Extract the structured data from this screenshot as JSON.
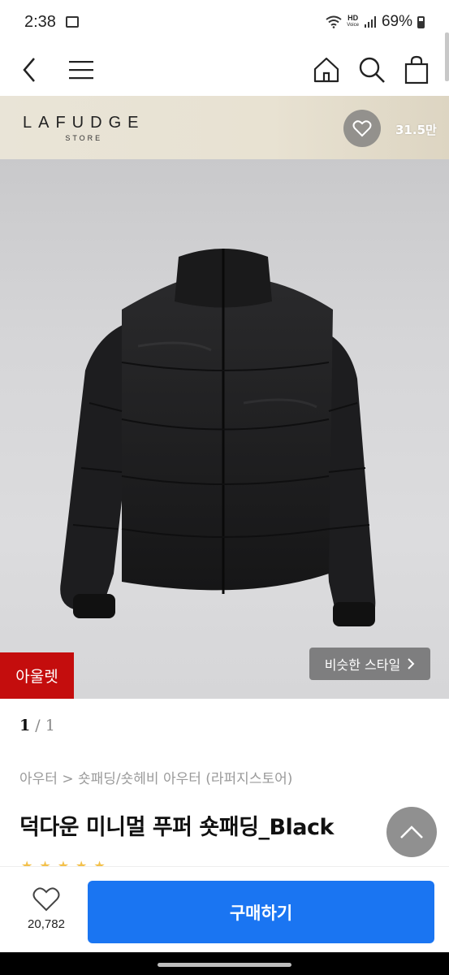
{
  "status_bar": {
    "time": "2:38",
    "network_label": "HD",
    "network_sub": "Voice",
    "battery": "69%"
  },
  "nav": {
    "back_icon": "back-arrow-icon",
    "menu_icon": "hamburger-menu-icon",
    "home_icon": "home-icon",
    "search_icon": "search-icon",
    "cart_icon": "shopping-bag-icon"
  },
  "store": {
    "name": "LAFUDGE",
    "sub": "STORE",
    "favorites": "31.5만"
  },
  "image": {
    "outlet_badge": "아울렛",
    "similar_style": "비슷한 스타일"
  },
  "gallery": {
    "current": "1",
    "total": "1"
  },
  "product": {
    "breadcrumb": "아우터 > 숏패딩/숏헤비 아우터 (라퍼지스토어)",
    "title": "덕다운 미니멀 푸퍼 숏패딩_Black"
  },
  "bottom_bar": {
    "like_count": "20,782",
    "buy_label": "구매하기"
  },
  "colors": {
    "accent": "#1a75f2",
    "outlet": "#c40d0d"
  }
}
